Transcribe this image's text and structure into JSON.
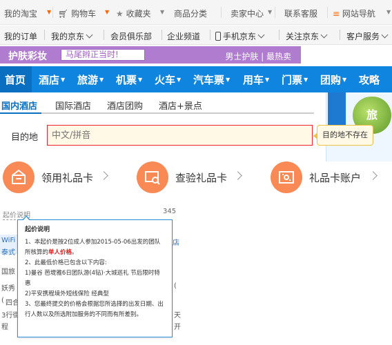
{
  "topbar": {
    "my_taobao": "我的淘宝",
    "cart": "购物车",
    "favorites": "收藏夹",
    "categories": "商品分类",
    "seller_center": "卖家中心",
    "contact": "联系客服",
    "site_nav": "网站导航"
  },
  "jdbar": {
    "my_order": "我的订单",
    "my_jd": "我的京东",
    "member_club": "会员俱乐部",
    "enterprise": "企业频道",
    "mobile_jd": "手机京东",
    "follow_jd": "关注京东",
    "service": "客户服务"
  },
  "promo": {
    "title": "护肤彩妆",
    "search_text": "马尾辫正当时!",
    "links": "男士护肤 | 最热卖"
  },
  "nav": {
    "items": [
      "首页",
      "酒店",
      "旅游",
      "机票",
      "火车",
      "汽车票",
      "用车",
      "门票",
      "团购",
      "攻略"
    ]
  },
  "hotel_tabs": [
    "国内酒店",
    "国际酒店",
    "酒店团购",
    "酒店+景点"
  ],
  "destination": {
    "label": "目的地",
    "placeholder": "中文/拼音",
    "error": "目的地不存在"
  },
  "gift": {
    "claim": "领用礼品卡",
    "check": "查验礼品卡",
    "account": "礼品卡账户"
  },
  "side_banner": {
    "badge": "旅"
  },
  "lower": {
    "price_desc": "起价说明",
    "number": "345",
    "fragments": [
      "WiFi",
      "泰式",
      "国旅",
      "妖秀",
      "四合",
      "3行街",
      "程",
      "店",
      "(",
      "(",
      "天",
      "开"
    ]
  },
  "tooltip": {
    "title": "起价说明",
    "line1_pre": "1、本起价是按2位成人参加2015-05-06出发的团队所核算的",
    "line1_red": "单人价格",
    "line1_post": "。",
    "line2": "2、此最低价格已包含以下内容:",
    "line3": "1)曼谷 芭堤雅6日团队游(4钻)·大城巡礼 节后限时特惠",
    "line4": "2)平安携程境外短线保险 经典型",
    "line5": "3、您最终提交的价格会根据您所选择的出发日期、出行人数以及所选附加服务的不同而有所差别。"
  },
  "colors": {
    "nav_blue": "#1085e0",
    "promo_purple": "#b07ccf",
    "gift_orange": "#f98a55",
    "error_red": "#e02020"
  }
}
